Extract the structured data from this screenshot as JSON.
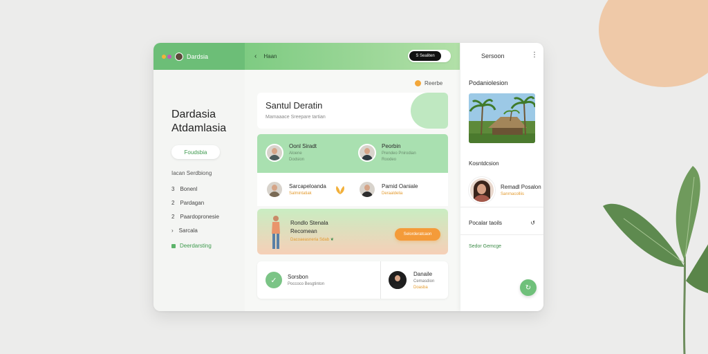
{
  "colors": {
    "accent_green": "#6cbe77",
    "accent_orange": "#f49b3a",
    "background": "#ececeb",
    "decor_peach": "#efc9a8"
  },
  "sidebar": {
    "header_label": "Dardsia",
    "title_line1": "Dardasia",
    "title_line2": "Atdamlasia",
    "pill": "Foudsbia",
    "section": "Iacan Serdbiong",
    "items": [
      {
        "num": "3",
        "label": "Bonenl"
      },
      {
        "num": "2",
        "label": "Pardagan"
      },
      {
        "num": "2",
        "label": "Paardopronesie"
      },
      {
        "num": "›",
        "label": "Sarcala"
      }
    ],
    "active": "Deerdarsting"
  },
  "header": {
    "back_label": "Haan",
    "toggle_label": "S Sealiten",
    "badge_label": "Reerbe"
  },
  "hero": {
    "title": "Santul Deratin",
    "subtitle": "Mamaaace Sreepare tartian"
  },
  "people": [
    {
      "name": "Oonl Siradt",
      "sub1": "Aloene",
      "sub2": "Dodsion"
    },
    {
      "name": "Peorbin",
      "sub1": "Prendeo Pnirodian",
      "sub2": "Roodeo"
    },
    {
      "name": "Sarcapeloanda",
      "sub1": "Salmintatiak"
    },
    {
      "name": "Pamid Oaniale",
      "sub1": "Deraaldelia"
    }
  ],
  "promo": {
    "name": "Rondlo Stenala",
    "sub": "Recomean",
    "sub2": "Dacoaeasneria Sdab",
    "button": "Selorderatcaon"
  },
  "bottom": {
    "left_name": "Sorsbon",
    "left_sub": "Poccoco Besgtinton",
    "right_name": "Danaile",
    "right_sub1": "Cemasdion",
    "right_sub2": "Doasba"
  },
  "panel": {
    "head": "Sersoon",
    "menu": "⋮",
    "section1": "Podaniolesion",
    "section2": "Kosntdcsion",
    "person_name": "Remadl Posalon",
    "person_sub": "Sanrnacolliis",
    "row_label": "Pocalar taoils",
    "row_icon": "↺",
    "green_label": "Sedor Gemcge",
    "fab": "↻"
  },
  "icons": {
    "back": "chevron-left-icon",
    "badge": "orange-dot-icon",
    "leaf": "leaf-icon",
    "refresh": "refresh-icon",
    "menu": "kebab-menu-icon"
  }
}
